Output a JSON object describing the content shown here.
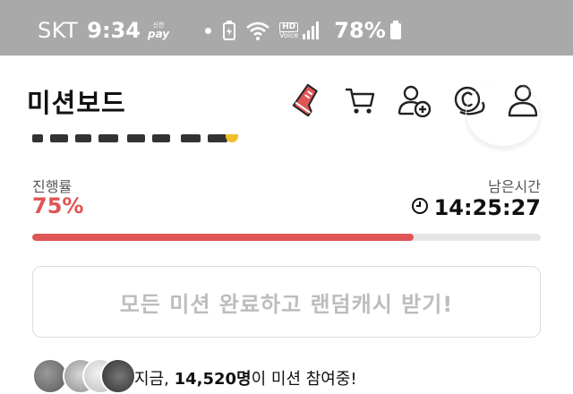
{
  "status_bar": {
    "carrier": "SKT",
    "time": "9:34",
    "pay_top": "신한",
    "pay_label": "pay",
    "hd_label": "HD",
    "voice_label": "Voice",
    "battery": "78%",
    "background_color": "#a9a9a9"
  },
  "header": {
    "title": "미션보드",
    "icons": [
      "shoe-icon",
      "cart-icon",
      "add-friend-icon",
      "coin-icon",
      "profile-icon"
    ]
  },
  "progress": {
    "label": "진행률",
    "value_text": "75%",
    "fraction": 0.75,
    "accent_color": "#e05555"
  },
  "remaining": {
    "label": "남은시간",
    "time": "14:25:27"
  },
  "reward_button": {
    "label": "모든 미션 완료하고 랜덤캐시 받기!"
  },
  "participants": {
    "prefix": "지금, ",
    "count": "14,520명",
    "suffix": "이 미션 참여중!"
  }
}
